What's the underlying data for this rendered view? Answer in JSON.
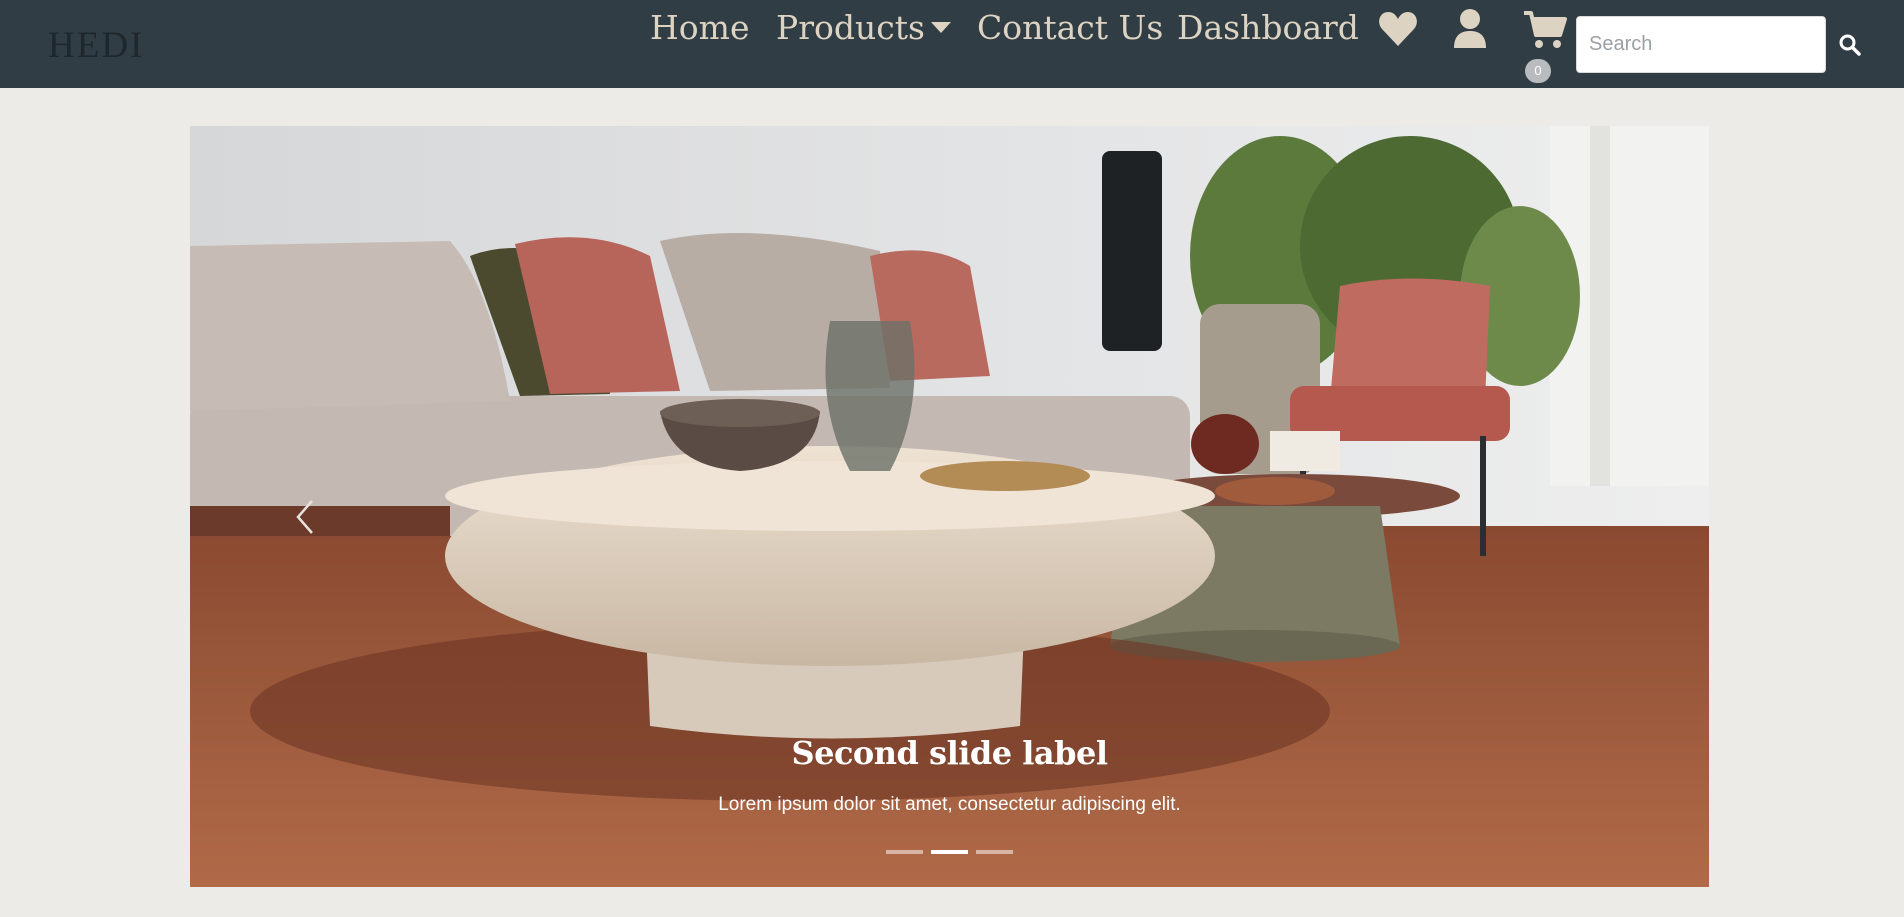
{
  "brand": {
    "logo_text": "HEDI"
  },
  "nav": {
    "home": "Home",
    "products": "Products",
    "contact": "Contact Us",
    "dashboard": "Dashboard"
  },
  "icons": {
    "wishlist": "heart-icon",
    "account": "user-icon",
    "cart": "cart-icon",
    "search": "search-icon",
    "prev": "chevron-left-icon"
  },
  "cart": {
    "count": "0"
  },
  "search": {
    "placeholder": "Search"
  },
  "carousel": {
    "active_index": 1,
    "slide_count": 3,
    "caption_title": "Second slide label",
    "caption_text": "Lorem ipsum dolor sit amet, consectetur adipiscing elit."
  },
  "colors": {
    "navbar": "#313d44",
    "nav_text": "#ddd3c3",
    "page_bg": "#ecebe8"
  }
}
